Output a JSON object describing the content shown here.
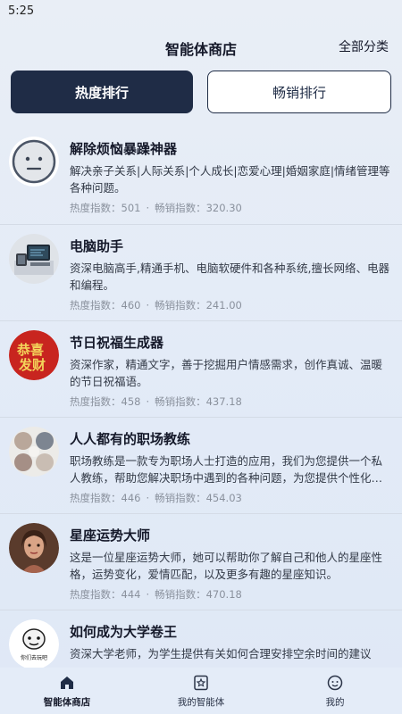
{
  "status_bar": {
    "time": "5:25"
  },
  "header": {
    "title": "智能体商店",
    "all_categories": "全部分类"
  },
  "tabs": [
    {
      "label": "热度排行",
      "active": true
    },
    {
      "label": "畅销排行",
      "active": false
    }
  ],
  "list": [
    {
      "title": "解除烦恼暴躁神器",
      "description": "解决亲子关系|人际关系|个人成长|恋爱心理|婚姻家庭|情绪管理等各种问题。",
      "heat_label": "热度指数：501",
      "sales_label": "畅销指数：320.30",
      "avatar_icon": "neutral-face-icon"
    },
    {
      "title": "电脑助手",
      "description": "资深电脑高手,精通手机、电脑软硬件和各种系统,擅长网络、电器和编程。",
      "heat_label": "热度指数：460",
      "sales_label": "畅销指数：241.00",
      "avatar_icon": "computer-icon"
    },
    {
      "title": "节日祝福生成器",
      "description": "资深作家，精通文字，善于挖掘用户情感需求，创作真诚、温暖的节日祝福语。",
      "heat_label": "热度指数：458",
      "sales_label": "畅销指数：437.18",
      "avatar_icon": "festival-calligraphy-icon",
      "avatar_text": "恭喜发财"
    },
    {
      "title": "人人都有的职场教练",
      "description": "职场教练是一款专为职场人士打造的应用，我们为您提供一个私人教练，帮助您解决职场中遇到的各种问题，为您提供个性化的建议和指导。",
      "heat_label": "热度指数：446",
      "sales_label": "畅销指数：454.03",
      "avatar_icon": "workplace-collage-icon"
    },
    {
      "title": "星座运势大师",
      "description": "这是一位星座运势大师，她可以帮助你了解自己和他人的星座性格，运势变化，爱情匹配，以及更多有趣的星座知识。",
      "heat_label": "热度指数：444",
      "sales_label": "畅销指数：470.18",
      "avatar_icon": "woman-portrait-icon"
    },
    {
      "title": "如何成为大学卷王",
      "description": "资深大学老师，为学生提供有关如何合理安排空余时间的建议",
      "heat_label": "",
      "sales_label": "",
      "avatar_icon": "meme-face-icon",
      "avatar_text": "你们去玩吧"
    }
  ],
  "bottom_nav": [
    {
      "label": "智能体商店",
      "icon": "home-icon",
      "active": true
    },
    {
      "label": "我的智能体",
      "icon": "bookmark-star-icon",
      "active": false
    },
    {
      "label": "我的",
      "icon": "smile-face-icon",
      "active": false
    }
  ],
  "colors": {
    "accent": "#1f2c46",
    "background": "#e6edf7",
    "muted_text": "#8a919d"
  }
}
